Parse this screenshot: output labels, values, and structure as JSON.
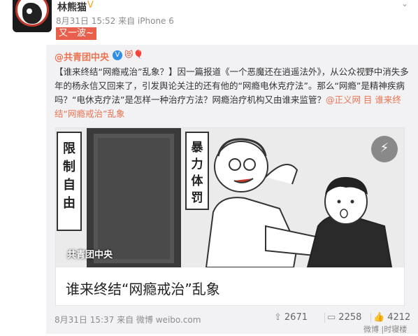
{
  "post": {
    "username": "林熊猫",
    "time": "8月31日 15:52 来自 iPhone 6",
    "text": "又一波~"
  },
  "repost": {
    "author": "@共青团中央",
    "text_plain": "【谁来终结“网瘾戒治”乱象？】因一篇报道《一个恶魔还在逍遥法外》，从公众视野中消失多年的杨永信又回来了，引发舆论关注的还有他的“网瘾电休克疗法”。那么“网瘾”是精神疾病吗？“电休克疗法”是怎样一种治疗方法？网瘾治疗机构又由谁来监管？",
    "text_link": "@正义网 目 谁来终结“网瘾戒治”乱象",
    "card": {
      "title": "谁来终结“网瘾戒治”乱象",
      "image_caption": "共青团中央",
      "sign_left": "限制自由",
      "sign_right": "暴力体罚"
    },
    "time": "8月31日 15:37 来自 微博 weibo.com",
    "stats": {
      "reposts": "2671",
      "comments": "2258",
      "likes": "4212"
    }
  },
  "watermark": "微博 |时寝楼"
}
